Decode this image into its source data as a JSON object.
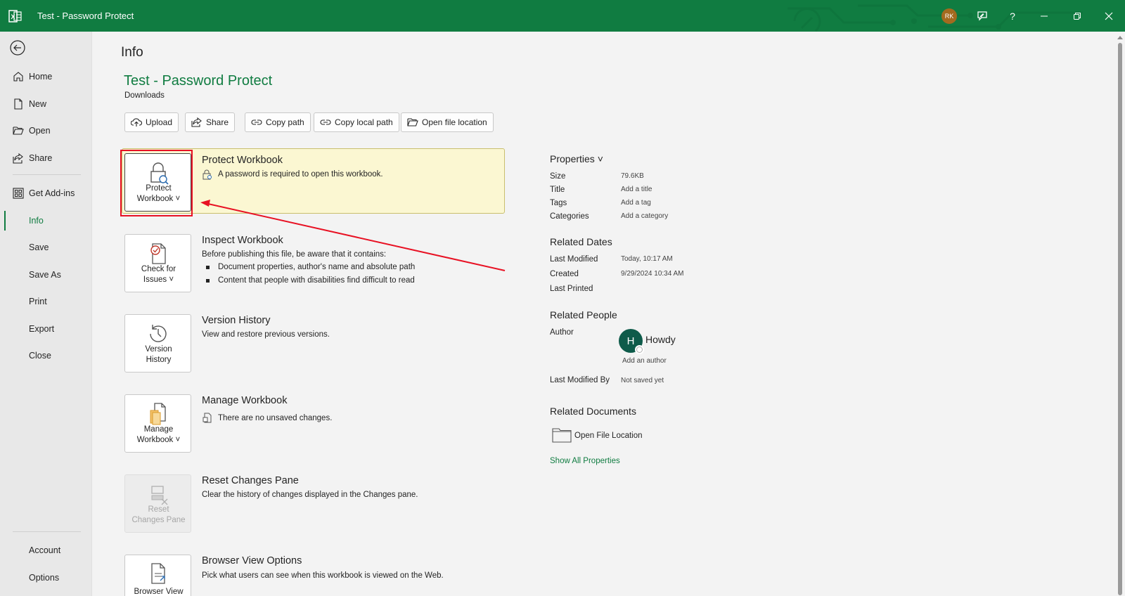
{
  "window": {
    "title": "Test - Password Protect",
    "user_initials": "RK"
  },
  "nav": {
    "items": [
      {
        "label": "Home"
      },
      {
        "label": "New"
      },
      {
        "label": "Open"
      },
      {
        "label": "Share"
      },
      {
        "label": "Get Add-ins"
      },
      {
        "label": "Info"
      },
      {
        "label": "Save"
      },
      {
        "label": "Save As"
      },
      {
        "label": "Print"
      },
      {
        "label": "Export"
      },
      {
        "label": "Close"
      },
      {
        "label": "Account"
      },
      {
        "label": "Options"
      }
    ],
    "active": "Info"
  },
  "page": {
    "heading": "Info",
    "file_title": "Test - Password Protect",
    "file_location": "Downloads",
    "actions": [
      "Upload",
      "Share",
      "Copy path",
      "Copy local path",
      "Open file location"
    ]
  },
  "sections": {
    "protect": {
      "btn_line1": "Protect",
      "btn_line2": "Workbook ˅",
      "title": "Protect Workbook",
      "desc": "A password is required to open this workbook."
    },
    "inspect": {
      "btn_line1": "Check for",
      "btn_line2": "Issues ˅",
      "title": "Inspect Workbook",
      "desc": "Before publishing this file, be aware that it contains:",
      "bullets": [
        "Document properties, author's name and absolute path",
        "Content that people with disabilities find difficult to read"
      ]
    },
    "version": {
      "btn_line1": "Version",
      "btn_line2": "History",
      "title": "Version History",
      "desc": "View and restore previous versions."
    },
    "manage": {
      "btn_line1": "Manage",
      "btn_line2": "Workbook ˅",
      "title": "Manage Workbook",
      "desc": "There are no unsaved changes."
    },
    "reset": {
      "btn_line1": "Reset",
      "btn_line2": "Changes Pane",
      "title": "Reset Changes Pane",
      "desc": "Clear the history of changes displayed in the Changes pane."
    },
    "browser": {
      "btn_line1": "Browser View",
      "title": "Browser View Options",
      "desc": "Pick what users can see when this workbook is viewed on the Web."
    }
  },
  "properties": {
    "heading": "Properties ˅",
    "rows": [
      {
        "key": "Size",
        "value": "79.6KB"
      },
      {
        "key": "Title",
        "value": "Add a title"
      },
      {
        "key": "Tags",
        "value": "Add a tag"
      },
      {
        "key": "Categories",
        "value": "Add a category"
      }
    ],
    "related_dates_heading": "Related Dates",
    "dates": [
      {
        "key": "Last Modified",
        "value": "Today, 10:17 AM"
      },
      {
        "key": "Created",
        "value": "9/29/2024 10:34 AM"
      },
      {
        "key": "Last Printed",
        "value": ""
      }
    ],
    "related_people_heading": "Related People",
    "author_label": "Author",
    "author_initial": "H",
    "author_name": "Howdy",
    "add_author": "Add an author",
    "last_modified_by_label": "Last Modified By",
    "last_modified_by_value": "Not saved yet",
    "related_docs_heading": "Related Documents",
    "open_file_location": "Open File Location",
    "show_all": "Show All Properties"
  },
  "colors": {
    "brand": "#107c41",
    "highlight_bg": "#fbf7d2",
    "annotation": "#e81123"
  }
}
